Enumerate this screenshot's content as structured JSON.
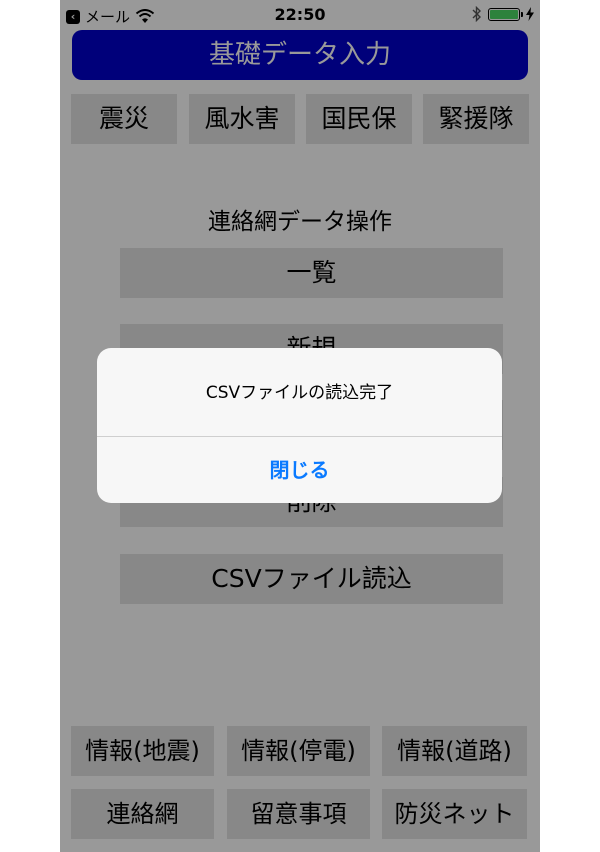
{
  "status_bar": {
    "carrier": "メール",
    "time": "22:50"
  },
  "header": {
    "title": "基礎データ入力"
  },
  "top_tabs": [
    "震災",
    "風水害",
    "国民保",
    "緊援隊"
  ],
  "section": {
    "label": "連絡網データ操作",
    "buttons": [
      "一覧",
      "新規",
      "",
      "削除",
      "CSVファイル読込"
    ]
  },
  "bottom_row1": [
    "情報(地震)",
    "情報(停電)",
    "情報(道路)"
  ],
  "bottom_row2": [
    "連絡網",
    "留意事項",
    "防災ネット"
  ],
  "alert": {
    "message": "CSVファイルの読込完了",
    "close_label": "閉じる"
  },
  "colors": {
    "header_bg": "#0000cc",
    "button_bg": "#e3e3e3",
    "alert_action": "#0a7aff",
    "battery": "#4cd964"
  }
}
